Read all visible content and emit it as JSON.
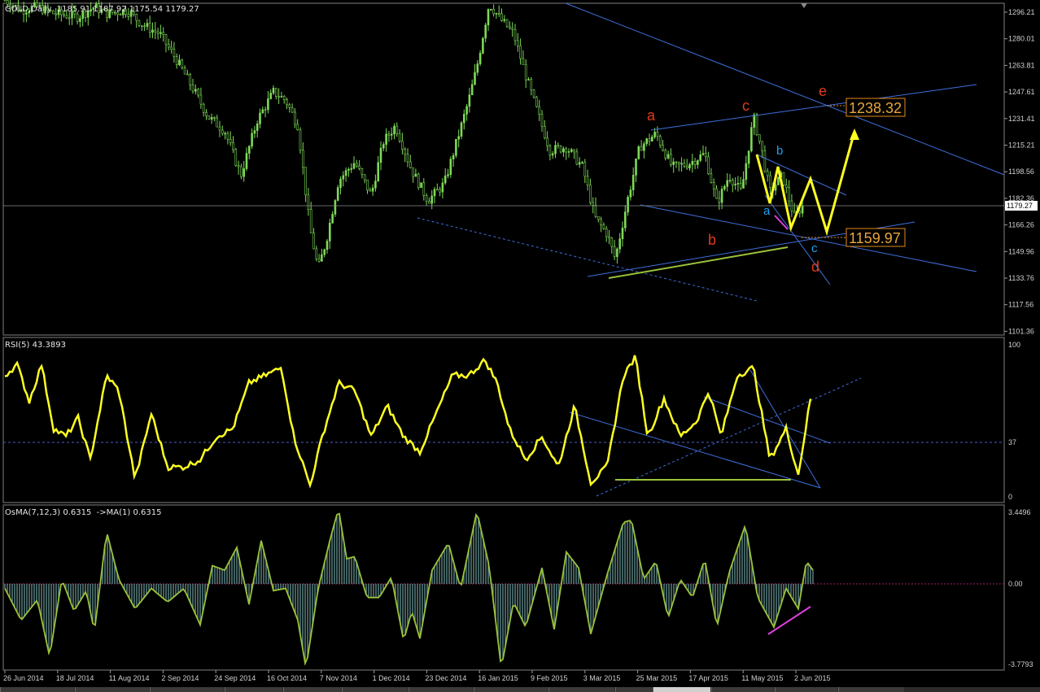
{
  "header": {
    "symbol": "GOLD,Daily",
    "ohlc": "1185.91 1187.92 1175.54 1179.27"
  },
  "price_axis": {
    "ticks": [
      "1296.21",
      "1280.01",
      "1263.81",
      "1247.61",
      "1231.41",
      "1215.21",
      "1198.56",
      "1182.36",
      "1166.26",
      "1149.96",
      "1133.76",
      "1117.56",
      "1101.36"
    ],
    "current_price": "1179.27"
  },
  "annotations": {
    "wave_red": [
      "a",
      "b",
      "c",
      "d",
      "e"
    ],
    "wave_blue": [
      "a",
      "b",
      "c"
    ],
    "target_high": "1238.32",
    "target_low": "1159.97"
  },
  "rsi": {
    "title": "RSI(5) 43.3893",
    "ticks": [
      "100",
      "37",
      "0"
    ]
  },
  "osma": {
    "title": "OsMA(7,12,3) 0.6315  ->MA(1) 0.6315",
    "ticks": [
      "3.4496",
      "0.00",
      "-3.7793"
    ]
  },
  "time_axis": {
    "labels": [
      "26 Jun 2014",
      "18 Jul 2014",
      "11 Aug 2014",
      "2 Sep 2014",
      "24 Sep 2014",
      "16 Oct 2014",
      "7 Nov 2014",
      "1 Dec 2014",
      "23 Dec 2014",
      "16 Jan 2015",
      "9 Feb 2015",
      "3 Mar 2015",
      "25 Mar 2015",
      "17 Apr 2015",
      "11 May 2015",
      "2 Jun 2015"
    ]
  },
  "chart_data": {
    "type": "candlestick",
    "title": "GOLD,Daily",
    "ylim": [
      1101.36,
      1296.21
    ],
    "price_path": [
      [
        0,
        1300
      ],
      [
        20,
        1294
      ],
      [
        40,
        1296
      ],
      [
        60,
        1292
      ],
      [
        90,
        1290
      ],
      [
        110,
        1296
      ],
      [
        125,
        1292
      ],
      [
        150,
        1294
      ],
      [
        170,
        1285
      ],
      [
        190,
        1280
      ],
      [
        210,
        1265
      ],
      [
        230,
        1248
      ],
      [
        250,
        1230
      ],
      [
        270,
        1222
      ],
      [
        290,
        1195
      ],
      [
        310,
        1228
      ],
      [
        330,
        1245
      ],
      [
        345,
        1240
      ],
      [
        360,
        1225
      ],
      [
        375,
        1163
      ],
      [
        385,
        1139
      ],
      [
        395,
        1156
      ],
      [
        410,
        1192
      ],
      [
        430,
        1203
      ],
      [
        450,
        1183
      ],
      [
        465,
        1215
      ],
      [
        480,
        1225
      ],
      [
        500,
        1198
      ],
      [
        520,
        1180
      ],
      [
        540,
        1190
      ],
      [
        555,
        1215
      ],
      [
        570,
        1240
      ],
      [
        580,
        1260
      ],
      [
        595,
        1298
      ],
      [
        610,
        1288
      ],
      [
        625,
        1280
      ],
      [
        640,
        1255
      ],
      [
        655,
        1232
      ],
      [
        670,
        1210
      ],
      [
        690,
        1212
      ],
      [
        710,
        1200
      ],
      [
        725,
        1170
      ],
      [
        740,
        1160
      ],
      [
        750,
        1145
      ],
      [
        765,
        1180
      ],
      [
        780,
        1212
      ],
      [
        800,
        1220
      ],
      [
        820,
        1200
      ],
      [
        840,
        1202
      ],
      [
        860,
        1208
      ],
      [
        875,
        1178
      ],
      [
        890,
        1195
      ],
      [
        905,
        1185
      ],
      [
        920,
        1230
      ],
      [
        930,
        1210
      ],
      [
        940,
        1185
      ],
      [
        955,
        1195
      ],
      [
        970,
        1170
      ],
      [
        982,
        1178
      ]
    ],
    "rsi_path": [
      [
        0,
        80
      ],
      [
        15,
        87
      ],
      [
        30,
        63
      ],
      [
        45,
        87
      ],
      [
        60,
        45
      ],
      [
        75,
        40
      ],
      [
        90,
        52
      ],
      [
        105,
        25
      ],
      [
        125,
        80
      ],
      [
        140,
        70
      ],
      [
        160,
        12
      ],
      [
        180,
        55
      ],
      [
        200,
        20
      ],
      [
        220,
        20
      ],
      [
        240,
        25
      ],
      [
        260,
        40
      ],
      [
        280,
        45
      ],
      [
        300,
        75
      ],
      [
        320,
        80
      ],
      [
        340,
        85
      ],
      [
        355,
        40
      ],
      [
        375,
        8
      ],
      [
        390,
        40
      ],
      [
        410,
        75
      ],
      [
        430,
        70
      ],
      [
        450,
        40
      ],
      [
        470,
        60
      ],
      [
        490,
        40
      ],
      [
        510,
        30
      ],
      [
        530,
        55
      ],
      [
        550,
        80
      ],
      [
        570,
        80
      ],
      [
        590,
        90
      ],
      [
        605,
        75
      ],
      [
        620,
        45
      ],
      [
        640,
        25
      ],
      [
        660,
        40
      ],
      [
        680,
        20
      ],
      [
        700,
        60
      ],
      [
        720,
        10
      ],
      [
        740,
        20
      ],
      [
        760,
        80
      ],
      [
        775,
        92
      ],
      [
        790,
        40
      ],
      [
        810,
        65
      ],
      [
        830,
        40
      ],
      [
        850,
        50
      ],
      [
        865,
        70
      ],
      [
        880,
        40
      ],
      [
        900,
        80
      ],
      [
        920,
        85
      ],
      [
        940,
        25
      ],
      [
        960,
        45
      ],
      [
        975,
        15
      ],
      [
        990,
        65
      ]
    ],
    "osma_path": [
      [
        0,
        -0.2
      ],
      [
        20,
        -1.6
      ],
      [
        40,
        -0.7
      ],
      [
        55,
        -3.2
      ],
      [
        70,
        0.2
      ],
      [
        85,
        -1.2
      ],
      [
        100,
        -0.3
      ],
      [
        110,
        -2.1
      ],
      [
        125,
        2.3
      ],
      [
        140,
        0.2
      ],
      [
        160,
        -1.1
      ],
      [
        180,
        -0.2
      ],
      [
        200,
        -0.8
      ],
      [
        220,
        -0.2
      ],
      [
        240,
        -1.8
      ],
      [
        255,
        0.8
      ],
      [
        270,
        0.6
      ],
      [
        285,
        1.6
      ],
      [
        300,
        -0.9
      ],
      [
        315,
        1.9
      ],
      [
        330,
        -0.3
      ],
      [
        345,
        -0.2
      ],
      [
        360,
        -1.6
      ],
      [
        370,
        -3.7
      ],
      [
        385,
        -0.2
      ],
      [
        400,
        2.0
      ],
      [
        410,
        3.3
      ],
      [
        420,
        1.1
      ],
      [
        430,
        1.2
      ],
      [
        445,
        -0.6
      ],
      [
        460,
        -0.6
      ],
      [
        475,
        0.3
      ],
      [
        490,
        -2.5
      ],
      [
        500,
        -1.2
      ],
      [
        510,
        -2.4
      ],
      [
        525,
        0.6
      ],
      [
        545,
        1.8
      ],
      [
        560,
        -0.2
      ],
      [
        580,
        3.2
      ],
      [
        595,
        0.8
      ],
      [
        610,
        -3.7
      ],
      [
        625,
        -0.8
      ],
      [
        640,
        -1.9
      ],
      [
        660,
        0.7
      ],
      [
        675,
        -2.0
      ],
      [
        690,
        1.4
      ],
      [
        705,
        0.7
      ],
      [
        720,
        -2.2
      ],
      [
        740,
        0.4
      ],
      [
        760,
        2.7
      ],
      [
        770,
        2.8
      ],
      [
        785,
        0.2
      ],
      [
        800,
        1.0
      ],
      [
        815,
        -1.5
      ],
      [
        830,
        0.2
      ],
      [
        845,
        -0.6
      ],
      [
        860,
        1.1
      ],
      [
        875,
        -1.9
      ],
      [
        890,
        0.5
      ],
      [
        910,
        2.6
      ],
      [
        925,
        -0.6
      ],
      [
        945,
        -1.9
      ],
      [
        960,
        -0.2
      ],
      [
        975,
        -1.1
      ],
      [
        985,
        1.0
      ],
      [
        993,
        0.6
      ]
    ]
  }
}
